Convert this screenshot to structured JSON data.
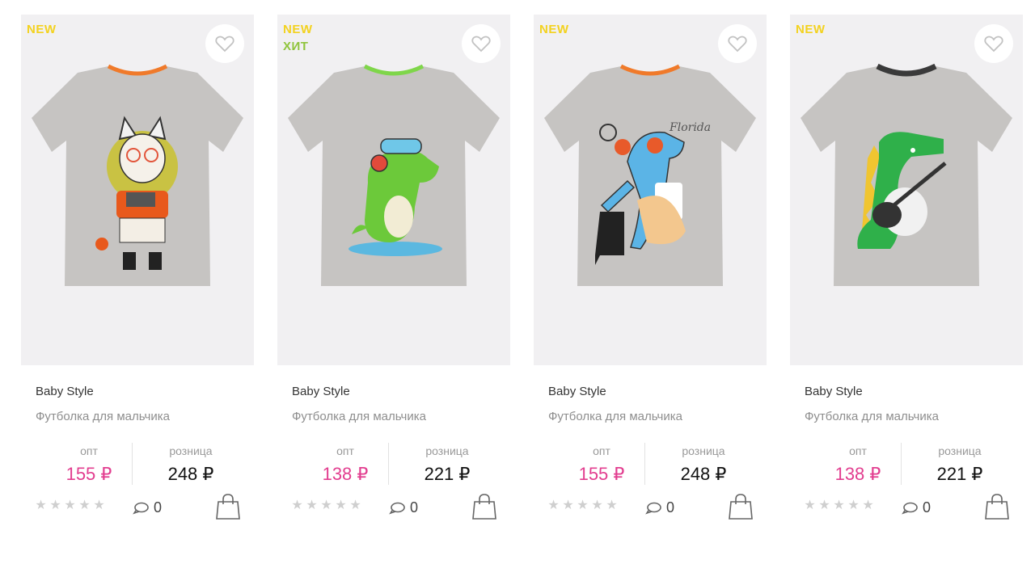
{
  "products": [
    {
      "badges": [
        "NEW"
      ],
      "brand": "Baby Style",
      "title": "Футболка для мальчика",
      "opt_label": "опт",
      "retail_label": "розница",
      "opt_price": "155 ₽",
      "retail_price": "248 ₽",
      "rating": 0,
      "comments": "0",
      "collar_color": "#f07a2a"
    },
    {
      "badges": [
        "NEW",
        "ХИТ"
      ],
      "brand": "Baby Style",
      "title": "Футболка для мальчика",
      "opt_label": "опт",
      "retail_label": "розница",
      "opt_price": "138 ₽",
      "retail_price": "221 ₽",
      "rating": 0,
      "comments": "0",
      "collar_color": "#7fd64a"
    },
    {
      "badges": [
        "NEW"
      ],
      "brand": "Baby Style",
      "title": "Футболка для мальчика",
      "opt_label": "опт",
      "retail_label": "розница",
      "opt_price": "155 ₽",
      "retail_price": "248 ₽",
      "rating": 0,
      "comments": "0",
      "collar_color": "#f07a2a"
    },
    {
      "badges": [
        "NEW"
      ],
      "brand": "Baby Style",
      "title": "Футболка для мальчика",
      "opt_label": "опт",
      "retail_label": "розница",
      "opt_price": "138 ₽",
      "retail_price": "221 ₽",
      "rating": 0,
      "comments": "0",
      "collar_color": "#3a3a3a"
    }
  ],
  "colors": {
    "badge_new": "#f3d21f",
    "badge_hit": "#8fc43b",
    "opt_price": "#e23d8f",
    "retail_price": "#111111"
  },
  "icons": {
    "favorite": "heart-icon",
    "comment": "comment-icon",
    "cart": "shopping-bag-icon",
    "rating": "star-icon"
  }
}
